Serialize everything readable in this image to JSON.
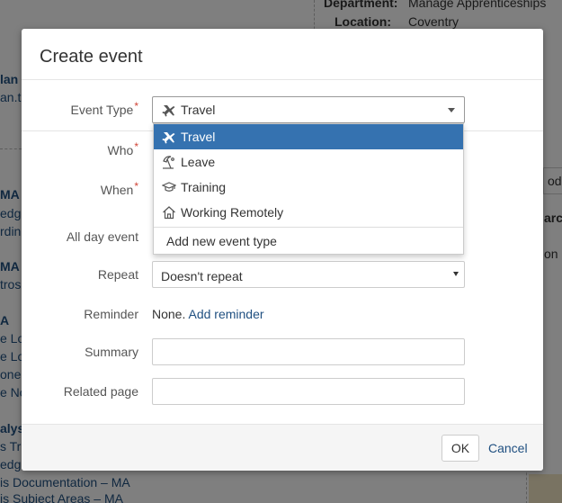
{
  "background": {
    "department_label": "Department:",
    "department_value": "Manage Apprenticeships",
    "location_label": "Location:",
    "location_value": "Coventry",
    "frag_lan": "lan",
    "frag_an_t": "an.t",
    "frag_ma1": "MA",
    "frag_edge1": "edge",
    "frag_rdin": "rdin",
    "frag_ma2": "MA",
    "frag_tros": "tros",
    "frag_a": "A",
    "frag_elo1": "e Lo",
    "frag_elo2": "e Lo",
    "frag_oner": "oner",
    "frag_eno": "e No",
    "frag_alys": "alys",
    "frag_str": "s Tr",
    "frag_edge2": "edge",
    "doc_link1": "is Documentation – MA",
    "doc_link2": "is Subject Areas – MA",
    "frag_oda": "oda",
    "frag_arch": "arch",
    "frag_on": "on"
  },
  "dialog": {
    "title": "Create event",
    "event_type": {
      "label": "Event Type",
      "required_mark": "*",
      "selected": "Travel",
      "selected_icon": "plane-icon",
      "options": [
        {
          "label": "Travel",
          "icon": "plane-icon",
          "selected": true
        },
        {
          "label": "Leave",
          "icon": "beach-umbrella-icon",
          "selected": false
        },
        {
          "label": "Training",
          "icon": "graduation-cap-icon",
          "selected": false
        },
        {
          "label": "Working Remotely",
          "icon": "house-icon",
          "selected": false
        }
      ],
      "add_new_label": "Add new event type"
    },
    "who": {
      "label": "Who",
      "required_mark": "*"
    },
    "when": {
      "label": "When",
      "required_mark": "*"
    },
    "all_day": {
      "label": "All day event"
    },
    "repeat": {
      "label": "Repeat",
      "value": "Doesn't repeat"
    },
    "reminder": {
      "label": "Reminder",
      "none_text": "None.",
      "add_link": "Add reminder"
    },
    "summary": {
      "label": "Summary",
      "value": ""
    },
    "related_page": {
      "label": "Related page",
      "value": ""
    },
    "footer": {
      "ok_label": "OK",
      "cancel_label": "Cancel"
    }
  },
  "colors": {
    "selected_option_bg": "#3572b0",
    "link": "#205081",
    "required": "#d04437"
  }
}
